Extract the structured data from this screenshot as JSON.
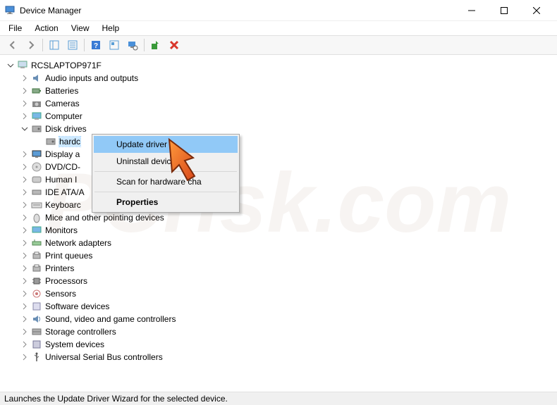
{
  "titlebar": {
    "title": "Device Manager"
  },
  "menubar": {
    "items": [
      "File",
      "Action",
      "View",
      "Help"
    ]
  },
  "tree": {
    "root": "RCSLAPTOP971F",
    "categories": [
      {
        "label": "Audio inputs and outputs",
        "expanded": false
      },
      {
        "label": "Batteries",
        "expanded": false
      },
      {
        "label": "Cameras",
        "expanded": false
      },
      {
        "label": "Computer",
        "expanded": false
      },
      {
        "label": "Disk drives",
        "expanded": true,
        "children": [
          {
            "label": "hardc"
          }
        ]
      },
      {
        "label": "Display a",
        "expanded": false
      },
      {
        "label": "DVD/CD-",
        "expanded": false
      },
      {
        "label": "Human I",
        "expanded": false
      },
      {
        "label": "IDE ATA/A",
        "expanded": false
      },
      {
        "label": "Keyboarc",
        "expanded": false
      },
      {
        "label": "Mice and other pointing devices",
        "expanded": false
      },
      {
        "label": "Monitors",
        "expanded": false
      },
      {
        "label": "Network adapters",
        "expanded": false
      },
      {
        "label": "Print queues",
        "expanded": false
      },
      {
        "label": "Printers",
        "expanded": false
      },
      {
        "label": "Processors",
        "expanded": false
      },
      {
        "label": "Sensors",
        "expanded": false
      },
      {
        "label": "Software devices",
        "expanded": false
      },
      {
        "label": "Sound, video and game controllers",
        "expanded": false
      },
      {
        "label": "Storage controllers",
        "expanded": false
      },
      {
        "label": "System devices",
        "expanded": false
      },
      {
        "label": "Universal Serial Bus controllers",
        "expanded": false
      }
    ]
  },
  "context_menu": {
    "items": [
      {
        "label": "Update driver",
        "highlight": true
      },
      {
        "label": "Uninstall device"
      },
      {
        "sep": true
      },
      {
        "label": "Scan for hardware cha"
      },
      {
        "sep": true
      },
      {
        "label": "Properties",
        "bold": true
      }
    ]
  },
  "statusbar": {
    "text": "Launches the Update Driver Wizard for the selected device."
  }
}
